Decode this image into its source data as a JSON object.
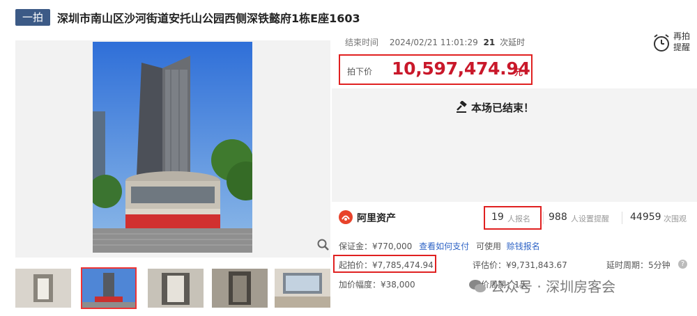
{
  "header": {
    "badge": "一拍",
    "title": "深圳市南山区沙河街道安托山公园西侧深铁懿府1栋E座1603"
  },
  "auction": {
    "end_time_label": "结束时间",
    "end_time_value": "2024/02/21 11:01:29",
    "delay_count": "21",
    "delay_unit": "次延时",
    "remind_label": "再拍提醒",
    "final_price_label": "拍下价",
    "final_price_value": "10,597,474.94",
    "final_price_unit": "元",
    "status_text": "本场已结束！"
  },
  "stats": {
    "platform_name": "阿里资产",
    "registered_count": "19",
    "registered_label": "人报名",
    "reminder_count": "988",
    "reminder_label": "人设置提醒",
    "watch_count": "44959",
    "watch_label": "次围观"
  },
  "details": {
    "deposit": "保证金：¥770,000",
    "how_to_pay": "查看如何支付",
    "can_use": "可使用",
    "earn_report": "赊钱报名",
    "start_price": "起拍价：¥7,785,474.94",
    "valuation": "评估价：¥9,731,843.67",
    "delay_period": "延时周期：5分钟",
    "increment": "加价幅度：¥38,000",
    "bid_period_partial": "竞价周期：1天"
  },
  "watermark": "公众号 · 深圳房客会",
  "colors": {
    "accent_red": "#c9182a",
    "highlight_border": "#e02020",
    "badge_bg": "#3c5a86",
    "link_blue": "#2f64c6"
  }
}
